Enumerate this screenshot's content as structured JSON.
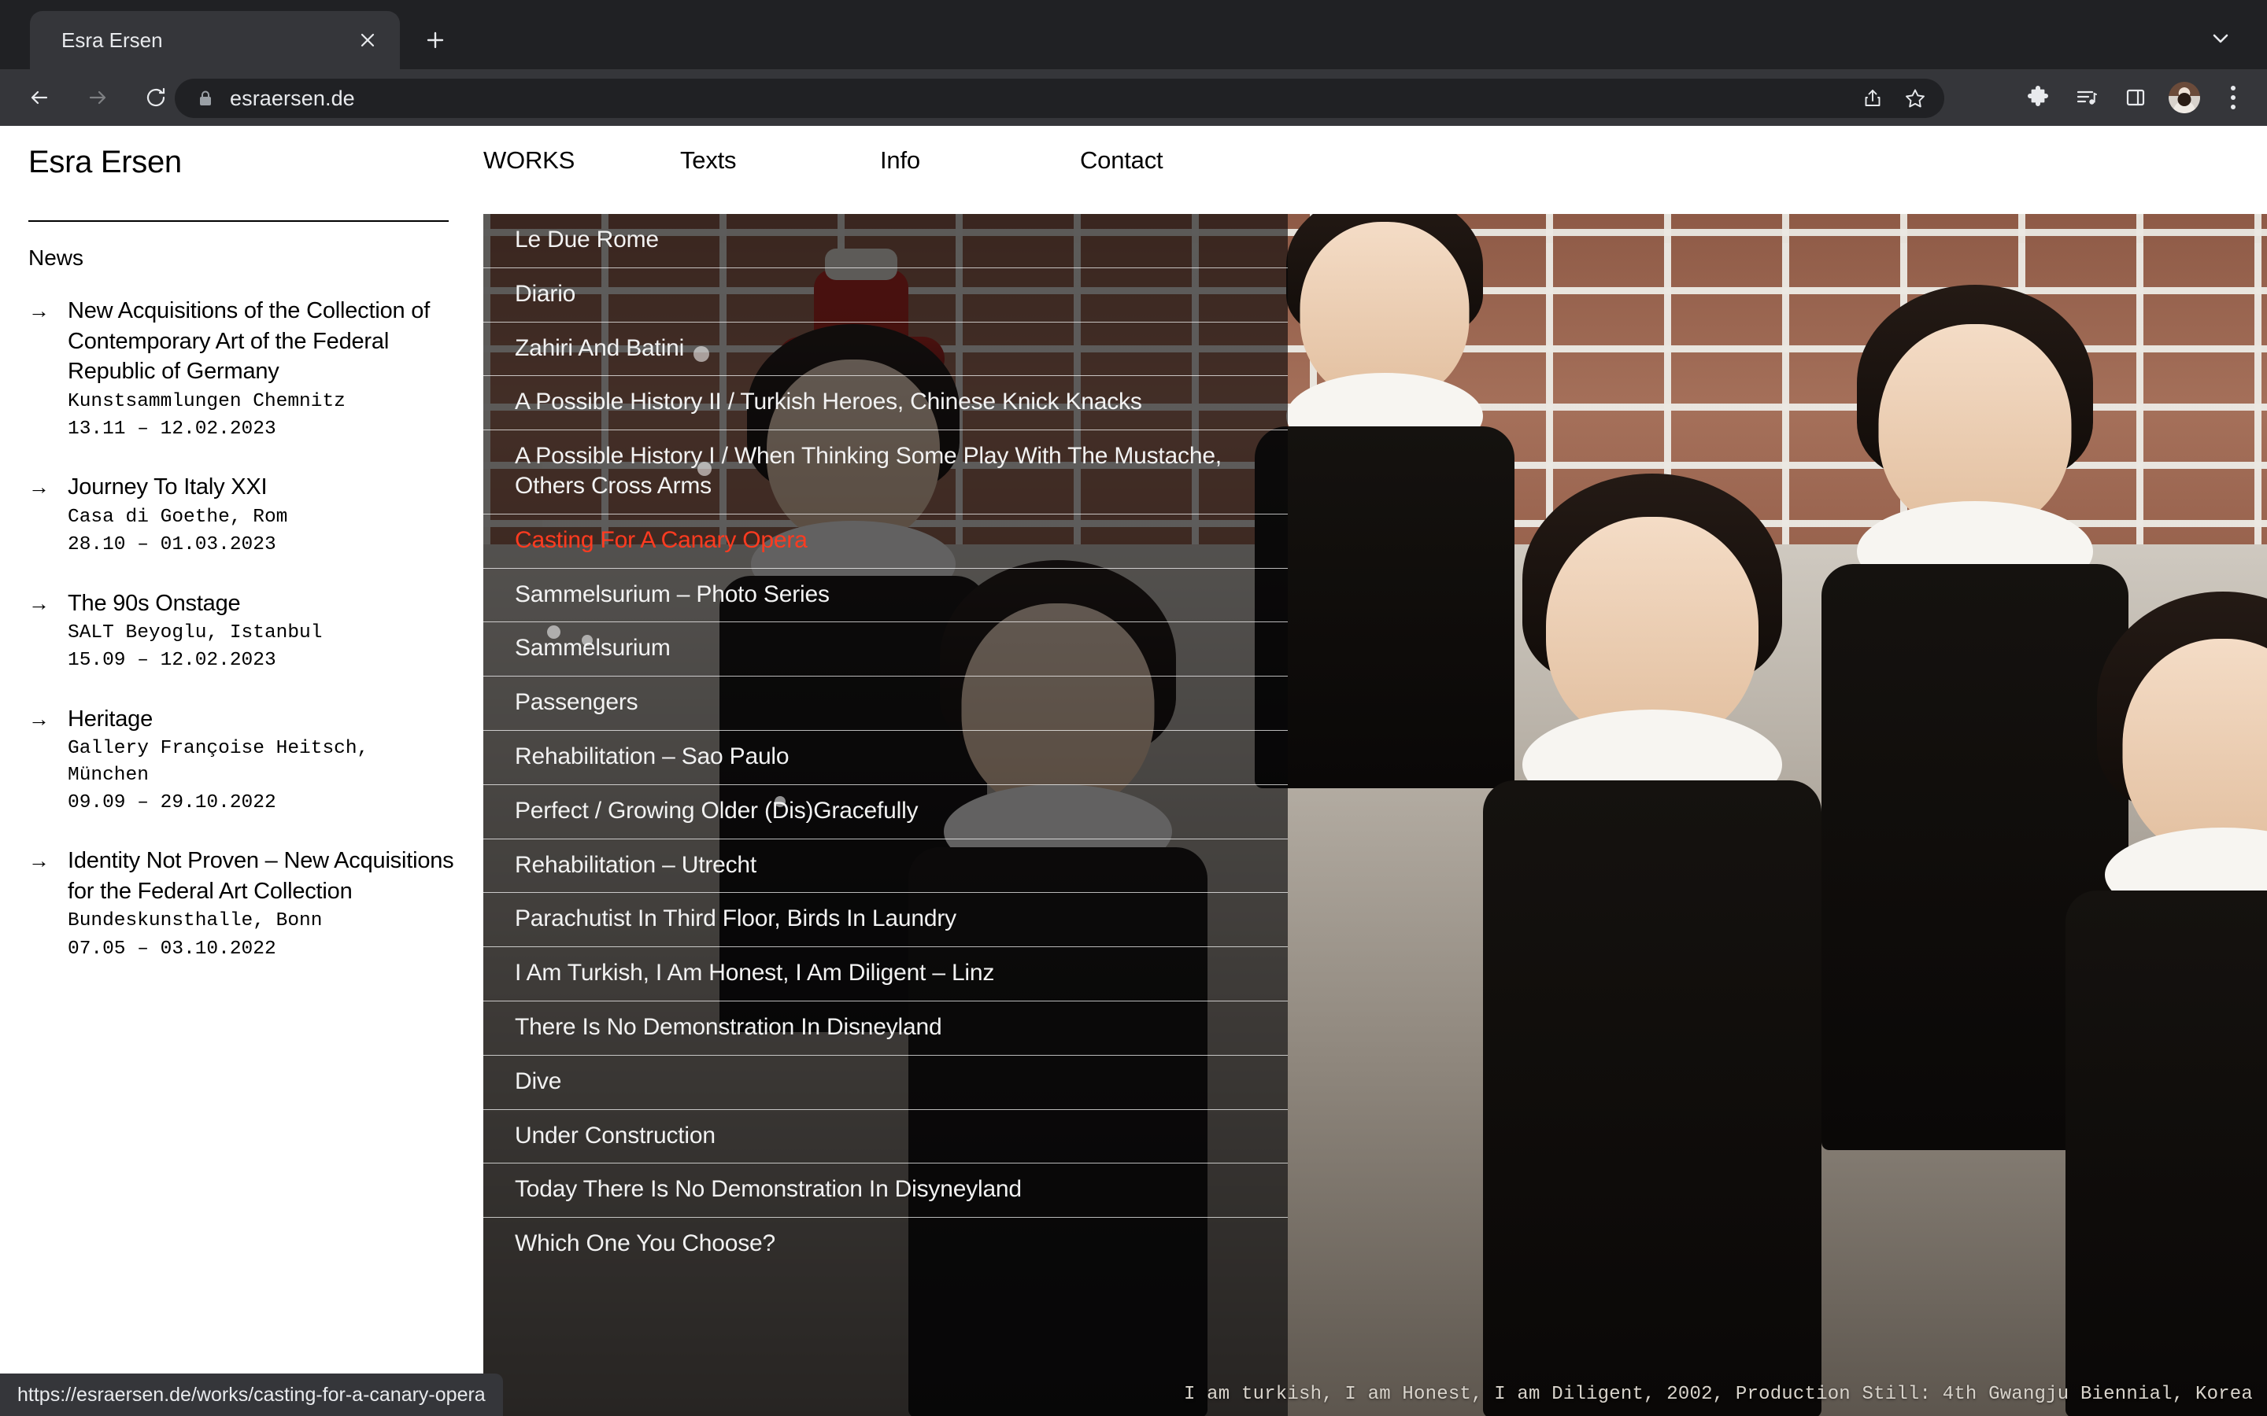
{
  "browser": {
    "tab": {
      "title": "Esra Ersen",
      "close_icon": "close-icon",
      "new_tab_icon": "plus-icon"
    },
    "tabstrip_chevron_icon": "chevron-down-icon",
    "back_icon": "arrow-left-icon",
    "forward_icon": "arrow-right-icon",
    "reload_icon": "reload-icon",
    "omnibox": {
      "lock_icon": "lock-icon",
      "url": "esraersen.de",
      "share_icon": "share-icon",
      "bookmark_icon": "star-icon"
    },
    "toolbar_right": {
      "extensions_icon": "puzzle-piece-icon",
      "media_icon": "media-playlist-icon",
      "side_panel_icon": "side-panel-icon",
      "profile_icon": "avatar-icon",
      "menu_icon": "three-dots-menu-icon"
    },
    "status_url": "https://esraersen.de/works/casting-for-a-canary-opera"
  },
  "sidebar": {
    "site_title": "Esra Ersen",
    "news_heading": "News",
    "arrow_glyph": "→",
    "news_items": [
      {
        "title": "New Acquisitions of the Collection of Contemporary Art of the Federal Republic of Germany",
        "venue": "Kunstsammlungen Chemnitz",
        "dates": "13.11 – 12.02.2023"
      },
      {
        "title": "Journey To Italy XXI",
        "venue": "Casa di Goethe, Rom",
        "dates": "28.10 – 01.03.2023"
      },
      {
        "title": "The 90s Onstage",
        "venue": "SALT Beyoglu, Istanbul",
        "dates": "15.09 – 12.02.2023"
      },
      {
        "title": "Heritage",
        "venue": "Gallery Françoise Heitsch, München",
        "dates": "09.09 – 29.10.2022"
      },
      {
        "title": "Identity Not Proven – New Acquisitions for the Federal Art Collection",
        "venue": "Bundeskunsthalle, Bonn",
        "dates": "07.05 – 03.10.2022"
      }
    ]
  },
  "nav": {
    "items": [
      {
        "label": "WORKS",
        "active": true
      },
      {
        "label": "Texts",
        "active": false
      },
      {
        "label": "Info",
        "active": false
      },
      {
        "label": "Contact",
        "active": false
      }
    ]
  },
  "works": {
    "active_color": "#ff3b20",
    "items": [
      {
        "title": "Le Due Rome",
        "active": false
      },
      {
        "title": "Diario",
        "active": false
      },
      {
        "title": "Zahiri And Batini",
        "active": false
      },
      {
        "title": "A Possible History II / Turkish Heroes, Chinese Knick Knacks",
        "active": false
      },
      {
        "title": "A Possible History I / When Thinking Some Play With The Mustache, Others Cross Arms",
        "active": false
      },
      {
        "title": "Casting For A Canary Opera",
        "active": true
      },
      {
        "title": "Sammelsurium – Photo Series",
        "active": false
      },
      {
        "title": "Sammelsurium",
        "active": false
      },
      {
        "title": "Passengers",
        "active": false
      },
      {
        "title": "Rehabilitation – Sao Paulo",
        "active": false
      },
      {
        "title": "Perfect / Growing Older (Dis)Gracefully",
        "active": false
      },
      {
        "title": "Rehabilitation – Utrecht",
        "active": false
      },
      {
        "title": "Parachutist In Third Floor, Birds In Laundry",
        "active": false
      },
      {
        "title": "I Am Turkish, I Am Honest, I Am Diligent – Linz",
        "active": false
      },
      {
        "title": "There Is No Demonstration In Disneyland",
        "active": false
      },
      {
        "title": "Dive",
        "active": false
      },
      {
        "title": "Under Construction",
        "active": false
      },
      {
        "title": "Today There Is No Demonstration In Disyneyland",
        "active": false
      },
      {
        "title": "Which One You Choose?",
        "active": false
      }
    ]
  },
  "artwork": {
    "caption": "I am turkish, I am Honest, I am Diligent, 2002, Production Still: 4th Gwangju Biennial, Korea"
  }
}
